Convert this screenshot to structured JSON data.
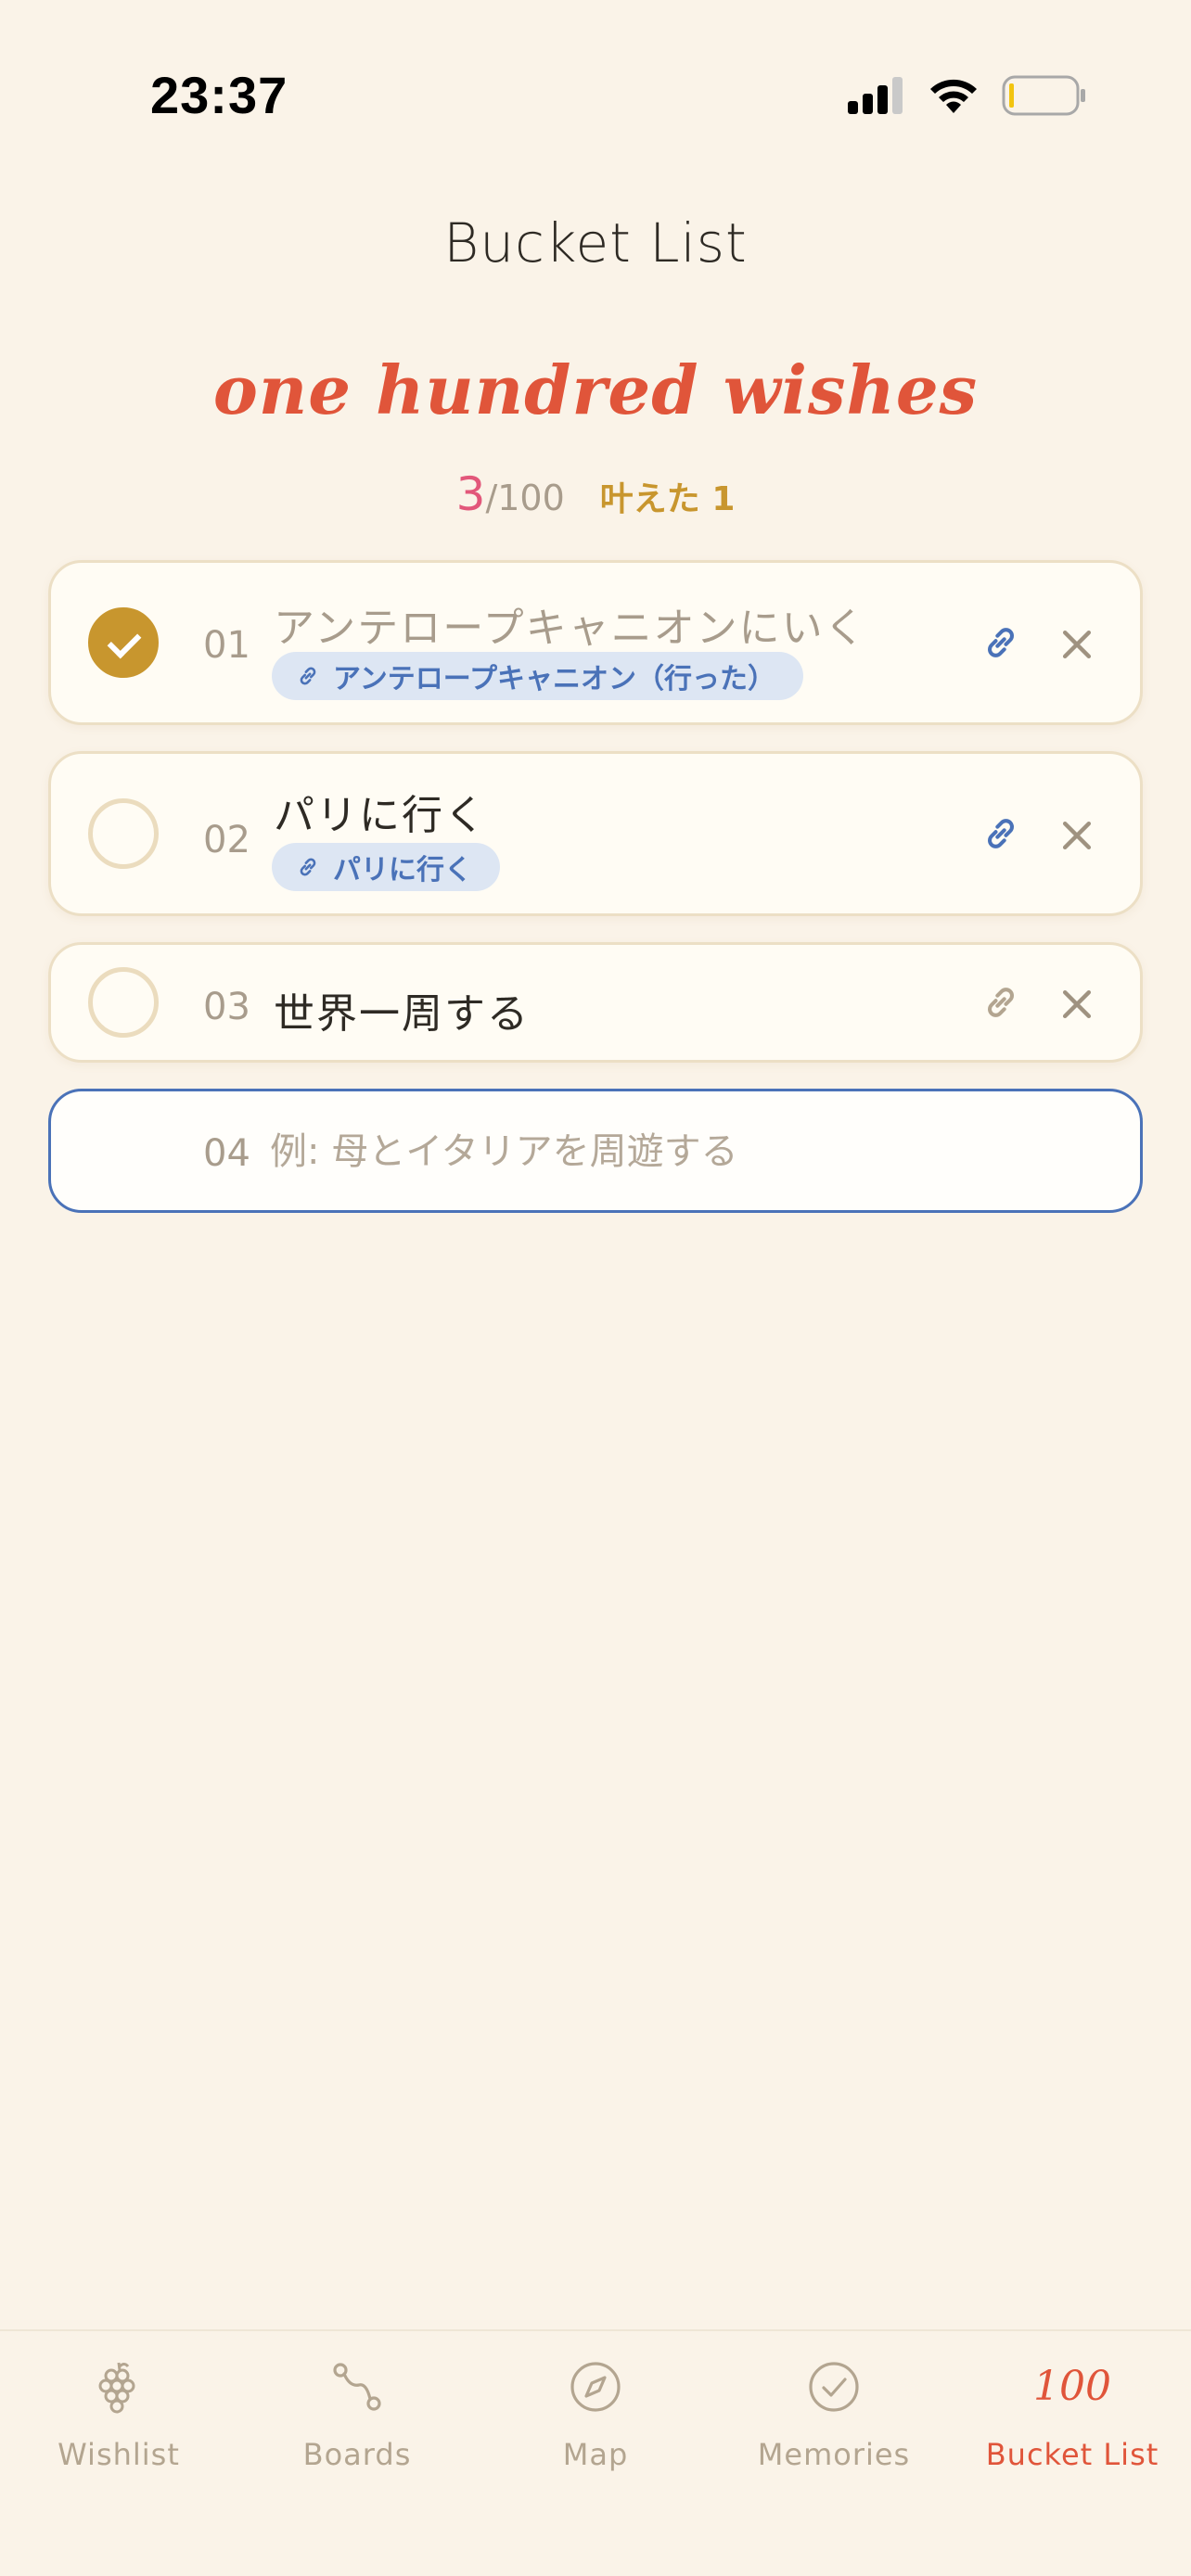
{
  "status": {
    "time": "23:37"
  },
  "header": {
    "title": "Bucket List",
    "subtitle": "one hundred wishes",
    "count_done": "3",
    "count_total": "/100",
    "achieved": "叶えた 1"
  },
  "items": [
    {
      "number": "01",
      "title": "アンテロープキャニオンにいく",
      "done": true,
      "tag": "アンテロープキャニオン（行った）",
      "linked": true
    },
    {
      "number": "02",
      "title": "パリに行く",
      "done": false,
      "tag": "パリに行く",
      "linked": true
    },
    {
      "number": "03",
      "title": "世界一周する",
      "done": false,
      "tag": "",
      "linked": false
    }
  ],
  "new_item": {
    "number": "04",
    "placeholder": "例: 母とイタリアを周遊する",
    "value": ""
  },
  "tabs": [
    {
      "label": "Wishlist",
      "icon": "grapes-icon"
    },
    {
      "label": "Boards",
      "icon": "route-icon"
    },
    {
      "label": "Map",
      "icon": "compass-icon"
    },
    {
      "label": "Memories",
      "icon": "check-circle-icon"
    },
    {
      "label": "Bucket List",
      "icon": "100",
      "active": true
    }
  ],
  "colors": {
    "background": "#faf3e8",
    "accent": "#e0553a",
    "gold": "#c8962e",
    "tag_blue": "#4a72b8",
    "pink": "#e2577a"
  }
}
